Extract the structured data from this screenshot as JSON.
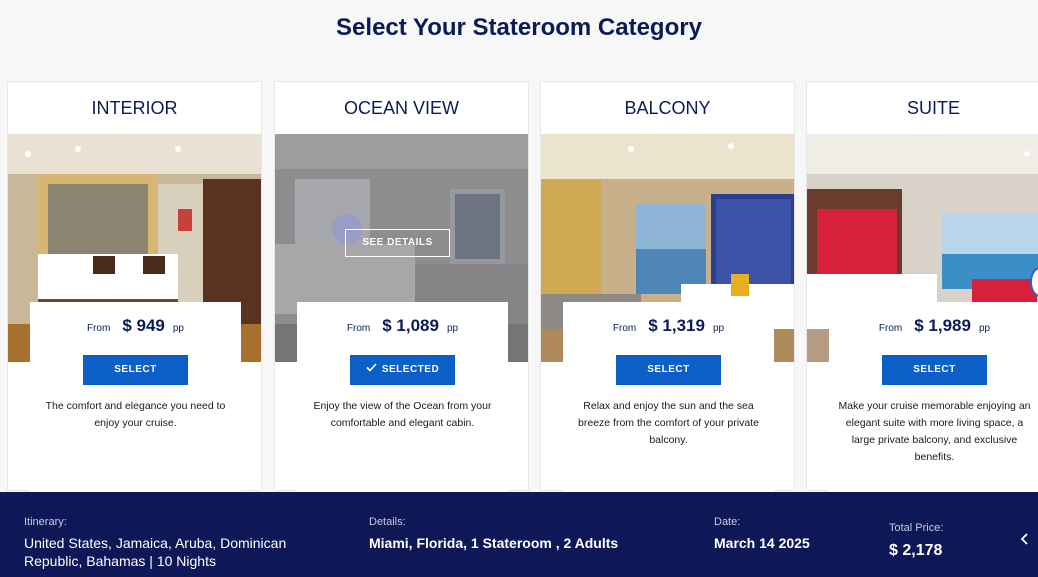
{
  "page": {
    "title": "Select Your Stateroom Category"
  },
  "cards": [
    {
      "title": "INTERIOR",
      "from": "From",
      "price": "$ 949",
      "pp": "pp",
      "button": "SELECT",
      "selected": false,
      "description": "The comfort and elegance you need to enjoy your cruise."
    },
    {
      "title": "OCEAN VIEW",
      "from": "From",
      "price": "$ 1,089",
      "pp": "pp",
      "button": "SELECTED",
      "selected": true,
      "overlay_label": "SEE DETAILS",
      "description": "Enjoy the view of the Ocean from your comfortable and elegant cabin."
    },
    {
      "title": "BALCONY",
      "from": "From",
      "price": "$ 1,319",
      "pp": "pp",
      "button": "SELECT",
      "selected": false,
      "description": "Relax and enjoy the sun and the sea breeze from the comfort of your private balcony."
    },
    {
      "title": "SUITE",
      "from": "From",
      "price": "$ 1,989",
      "pp": "pp",
      "button": "SELECT",
      "selected": false,
      "description": "Make your cruise memorable enjoying an elegant suite with more living space, a large private balcony, and exclusive benefits."
    }
  ],
  "footer": {
    "itinerary_label": "Itinerary:",
    "itinerary_value": "United States, Jamaica, Aruba, Dominican Republic, Bahamas | 10 Nights",
    "details_label": "Details:",
    "details_value": "Miami, Florida, 1 Stateroom , 2 Adults",
    "date_label": "Date:",
    "date_value": "March 14 2025",
    "total_label": "Total Price:",
    "total_value": "$ 2,178"
  },
  "colors": {
    "navy": "#0e1856",
    "accent_blue": "#0b5fc7",
    "title": "#0b1c55"
  },
  "icons": {
    "selected_check": "check-icon",
    "footer_toggle": "chevron-left-icon"
  }
}
